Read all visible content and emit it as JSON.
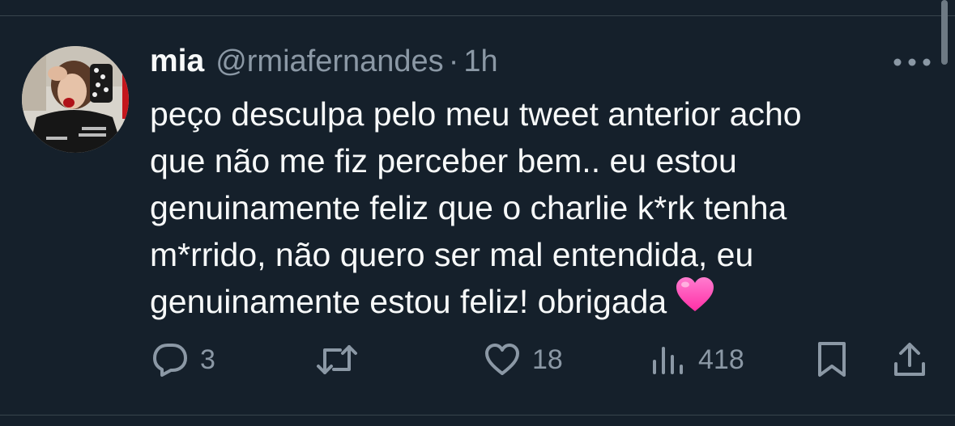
{
  "tweet": {
    "display_name": "mia",
    "handle": "@rmiafernandes",
    "separator": "·",
    "time": "1h",
    "text_lines": [
      "peço desculpa pelo meu tweet anterior acho",
      "que não me fiz perceber bem.. eu estou",
      "genuinamente feliz que o charlie k*rk tenha",
      "m*rrido, não quero ser mal entendida, eu",
      "genuinamente estou feliz! obrigada"
    ],
    "emoji": "pink-heart"
  },
  "actions": {
    "replies": "3",
    "likes": "18",
    "views": "418"
  },
  "icons": {
    "reply": "speech-bubble-icon",
    "retweet": "retweet-icon",
    "like": "heart-icon",
    "views": "bar-chart-icon",
    "bookmark": "bookmark-icon",
    "share": "share-icon",
    "more": "more-dots-icon"
  },
  "colors": {
    "background": "#15202b",
    "text_primary": "#f7f9f9",
    "text_secondary": "#8b98a5",
    "divider": "#38444d",
    "heart_emoji": "#ff4fb8"
  }
}
